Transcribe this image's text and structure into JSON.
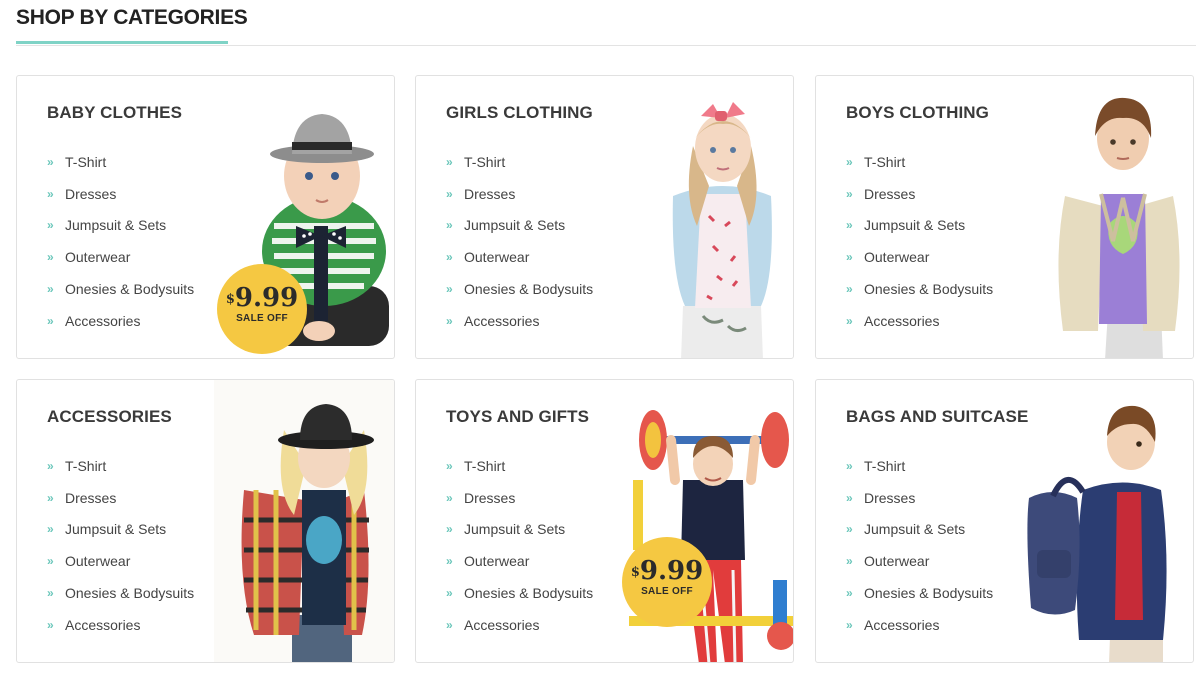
{
  "section": {
    "title": "SHOP BY CATEGORIES"
  },
  "categories": [
    {
      "title": "BABY CLOTHES",
      "items": [
        "T-Shirt",
        "Dresses",
        "Jumpsuit & Sets",
        "Outerwear",
        "Onesies & Bodysuits",
        "Accessories"
      ],
      "badge": {
        "currency": "$",
        "price": "9.99",
        "label": "SALE OFF"
      }
    },
    {
      "title": "GIRLS CLOTHING",
      "items": [
        "T-Shirt",
        "Dresses",
        "Jumpsuit & Sets",
        "Outerwear",
        "Onesies & Bodysuits",
        "Accessories"
      ]
    },
    {
      "title": "BOYS CLOTHING",
      "items": [
        "T-Shirt",
        "Dresses",
        "Jumpsuit & Sets",
        "Outerwear",
        "Onesies & Bodysuits",
        "Accessories"
      ]
    },
    {
      "title": "ACCESSORIES",
      "items": [
        "T-Shirt",
        "Dresses",
        "Jumpsuit & Sets",
        "Outerwear",
        "Onesies & Bodysuits",
        "Accessories"
      ]
    },
    {
      "title": "TOYS AND GIFTS",
      "items": [
        "T-Shirt",
        "Dresses",
        "Jumpsuit & Sets",
        "Outerwear",
        "Onesies & Bodysuits",
        "Accessories"
      ],
      "badge": {
        "currency": "$",
        "price": "9.99",
        "label": "SALE OFF"
      }
    },
    {
      "title": "BAGS AND SUITCASE",
      "items": [
        "T-Shirt",
        "Dresses",
        "Jumpsuit & Sets",
        "Outerwear",
        "Onesies & Bodysuits",
        "Accessories"
      ]
    }
  ],
  "theme": {
    "accent": "#7fd3c6",
    "badge": "#f5c842"
  }
}
